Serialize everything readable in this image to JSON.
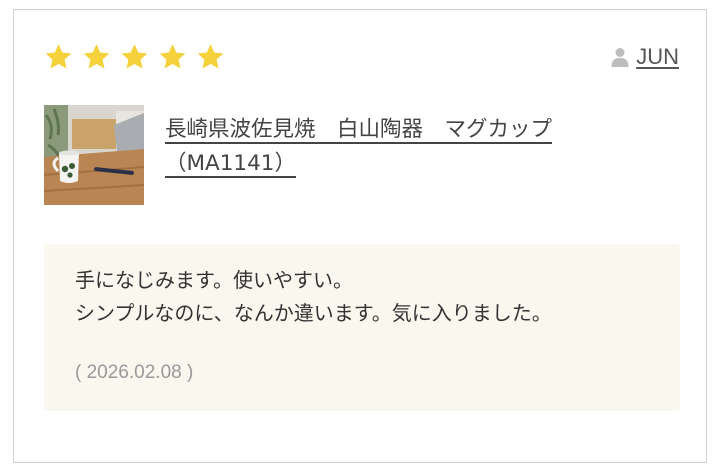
{
  "review": {
    "rating": 5,
    "max_rating": 5,
    "star_color": "#f5d23c",
    "user_name": "JUN",
    "user_icon": "user-icon",
    "product_title": "長崎県波佐見焼　白山陶器　マグカップ（MA1141）",
    "body_lines": [
      "手になじみます。使いやすい。",
      "シンプルなのに、なんか違います。気に入りました。"
    ],
    "date": "( 2026.02.08 )"
  }
}
